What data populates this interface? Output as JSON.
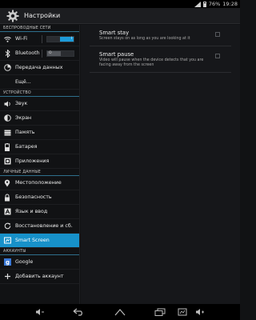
{
  "status": {
    "battery": "76%",
    "time": "19:28"
  },
  "app": {
    "title": "Настройки"
  },
  "sections": {
    "wireless": "БЕСПРОВОДНЫЕ СЕТИ",
    "device": "УСТРОЙСТВО",
    "personal": "ЛИЧНЫЕ ДАННЫЕ",
    "accounts": "АККАУНТЫ"
  },
  "items": {
    "wifi": "Wi-Fi",
    "wifi_toggle": "I",
    "bluetooth": "Bluetooth",
    "bluetooth_toggle": "O",
    "data": "Передача данных",
    "more": "Ещё...",
    "sound": "Звук",
    "display": "Экран",
    "memory": "Память",
    "battery": "Батарея",
    "apps": "Приложения",
    "location": "Местоположение",
    "security": "Безопасность",
    "language": "Язык и ввод",
    "backup": "Восстановление и сб.",
    "smartscreen": "Smart Screen",
    "google": "Google",
    "add_account": "Добавить аккаунт"
  },
  "detail": {
    "smart_stay_title": "Smart stay",
    "smart_stay_summary": "Screen stays on as long as you are looking at it",
    "smart_pause_title": "Smart pause",
    "smart_pause_summary": "Video will pause when the device detects that you are facing away from the screen"
  },
  "colors": {
    "accent": "#1791c9",
    "toggle_on": "#1d9bd9"
  },
  "icons": [
    "wifi-icon",
    "bluetooth-icon",
    "data-usage-icon",
    "sound-icon",
    "display-icon",
    "storage-icon",
    "battery-icon",
    "apps-icon",
    "location-icon",
    "security-icon",
    "language-icon",
    "backup-icon",
    "smart-screen-icon",
    "google-icon",
    "add-icon",
    "back-icon",
    "home-icon",
    "recents-icon",
    "screenshot-icon",
    "volume-down-icon",
    "volume-up-icon"
  ]
}
